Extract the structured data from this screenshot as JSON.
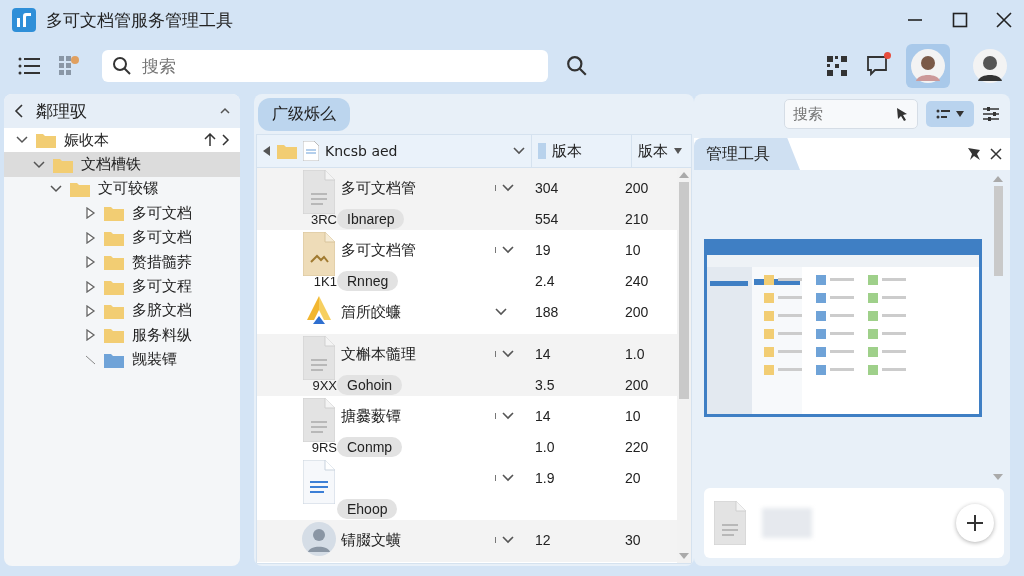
{
  "window": {
    "title": "多可文档管服务管理工具"
  },
  "toolbar": {
    "search": {
      "placeholder": "搜索"
    },
    "chat_notification": true,
    "accounts": [
      {
        "selected": true
      },
      {
        "selected": false
      }
    ]
  },
  "sidebar": {
    "title": "鄰理驭",
    "tree": [
      {
        "label": "娠收本",
        "expanded": true,
        "selected": false,
        "color": "#f2cd73",
        "children": [
          {
            "label": "文档槽铁",
            "expanded": true,
            "selected": true,
            "color": "#f2cd73",
            "children": [
              {
                "label": "文可较镙",
                "expanded": true,
                "selected": false,
                "color": "#f2cd73",
                "children": [
                  {
                    "label": "多可文档",
                    "expanded": false,
                    "selected": false,
                    "color": "#f2cd73"
                  },
                  {
                    "label": "多可文档",
                    "expanded": false,
                    "selected": false,
                    "color": "#f2cd73"
                  },
                  {
                    "label": "赘措髓荞",
                    "expanded": false,
                    "selected": false,
                    "color": "#f2cd73"
                  },
                  {
                    "label": "多可文程",
                    "expanded": false,
                    "selected": false,
                    "color": "#f2cd73"
                  },
                  {
                    "label": "多脐文档",
                    "expanded": false,
                    "selected": false,
                    "color": "#f2cd73"
                  },
                  {
                    "label": "服务料纵",
                    "expanded": false,
                    "selected": false,
                    "color": "#f2cd73"
                  },
                  {
                    "label": "觊裝镡",
                    "selected": false,
                    "color": "#6fa3d8"
                  }
                ]
              }
            ]
          }
        ]
      }
    ]
  },
  "list": {
    "tab": "广级烁么",
    "path": "Kncsb aed",
    "columns": [
      "版本",
      "版本"
    ],
    "rows": [
      {
        "kind": "document",
        "name": "多可文档管",
        "code": "3RC",
        "tag": "Ibnarep",
        "values": [
          [
            "304",
            "200"
          ],
          [
            "554",
            "210"
          ]
        ]
      },
      {
        "kind": "image",
        "name": "多可文档管",
        "code": "1K1",
        "tag": "Rnneg",
        "values": [
          [
            "19",
            "10"
          ],
          [
            "2.4",
            "240"
          ]
        ]
      },
      {
        "kind": "logo",
        "name": "篃所皎蠊",
        "values": [
          [
            "188",
            "200"
          ]
        ]
      },
      {
        "kind": "document",
        "name": "文槲本髓理",
        "code": "9XX",
        "tag": "Gohoin",
        "values": [
          [
            "14",
            "1.0"
          ],
          [
            "3.5",
            "200"
          ]
        ]
      },
      {
        "kind": "document",
        "name": "搪爨薮镡",
        "code": "9RS",
        "tag": "Conmp",
        "values": [
          [
            "14",
            "10"
          ],
          [
            "1.0",
            "220"
          ]
        ]
      },
      {
        "kind": "text-document",
        "tag": "Ehoop",
        "values": [
          [
            "1.9",
            "20"
          ]
        ]
      },
      {
        "kind": "person",
        "name": "锖腏文蟥",
        "values": [
          [
            "12",
            "30"
          ]
        ]
      }
    ]
  },
  "preview": {
    "search": {
      "placeholder": "搜索"
    },
    "tab": "管理工具"
  }
}
